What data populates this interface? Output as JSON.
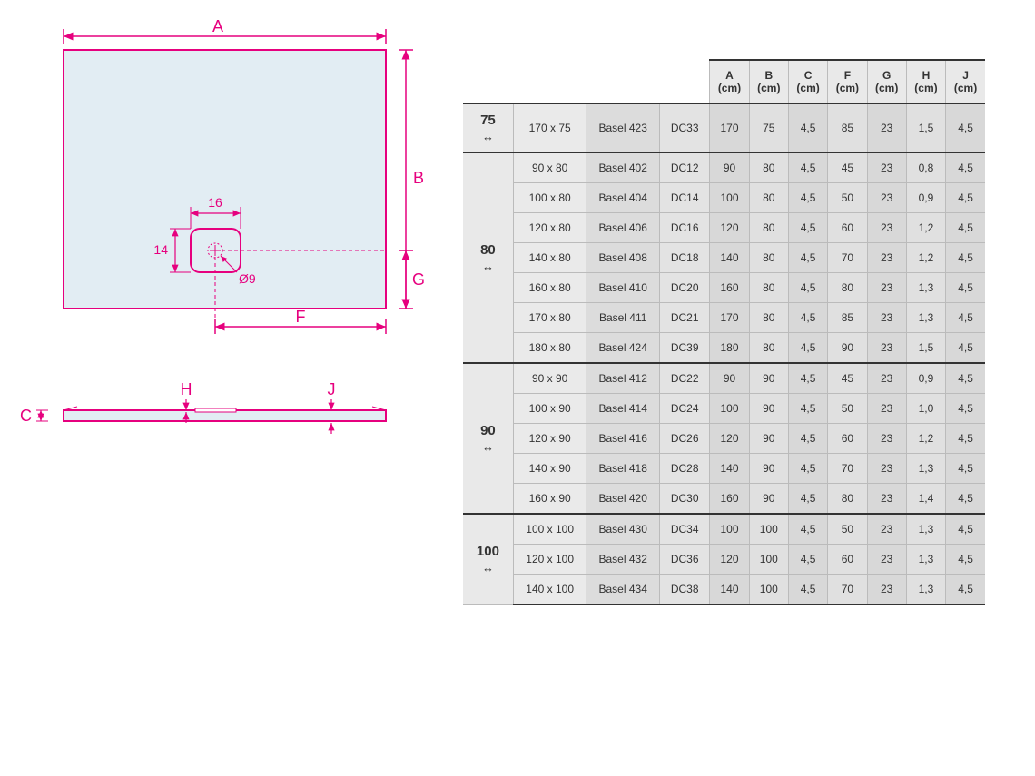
{
  "diagram": {
    "labels": {
      "A": "A",
      "B": "B",
      "C": "C",
      "F": "F",
      "G": "G",
      "H": "H",
      "J": "J",
      "drain_w": "16",
      "drain_h": "14",
      "drain_dia": "Ø9"
    },
    "colors": {
      "annotation": "#e6007e",
      "fill": "#e2edf3",
      "outline": "#e6007e"
    }
  },
  "table": {
    "columns": [
      "A (cm)",
      "B (cm)",
      "C (cm)",
      "F (cm)",
      "G (cm)",
      "H (cm)",
      "J (cm)"
    ],
    "groups": [
      {
        "width": "75",
        "rows": [
          {
            "size": "170 x 75",
            "model": "Basel 423",
            "code": "DC33",
            "A": "170",
            "B": "75",
            "C": "4,5",
            "F": "85",
            "G": "23",
            "H": "1,5",
            "J": "4,5"
          }
        ]
      },
      {
        "width": "80",
        "rows": [
          {
            "size": "90 x 80",
            "model": "Basel 402",
            "code": "DC12",
            "A": "90",
            "B": "80",
            "C": "4,5",
            "F": "45",
            "G": "23",
            "H": "0,8",
            "J": "4,5"
          },
          {
            "size": "100 x 80",
            "model": "Basel 404",
            "code": "DC14",
            "A": "100",
            "B": "80",
            "C": "4,5",
            "F": "50",
            "G": "23",
            "H": "0,9",
            "J": "4,5"
          },
          {
            "size": "120 x 80",
            "model": "Basel 406",
            "code": "DC16",
            "A": "120",
            "B": "80",
            "C": "4,5",
            "F": "60",
            "G": "23",
            "H": "1,2",
            "J": "4,5"
          },
          {
            "size": "140 x 80",
            "model": "Basel 408",
            "code": "DC18",
            "A": "140",
            "B": "80",
            "C": "4,5",
            "F": "70",
            "G": "23",
            "H": "1,2",
            "J": "4,5"
          },
          {
            "size": "160 x 80",
            "model": "Basel 410",
            "code": "DC20",
            "A": "160",
            "B": "80",
            "C": "4,5",
            "F": "80",
            "G": "23",
            "H": "1,3",
            "J": "4,5"
          },
          {
            "size": "170 x 80",
            "model": "Basel 411",
            "code": "DC21",
            "A": "170",
            "B": "80",
            "C": "4,5",
            "F": "85",
            "G": "23",
            "H": "1,3",
            "J": "4,5"
          },
          {
            "size": "180 x 80",
            "model": "Basel 424",
            "code": "DC39",
            "A": "180",
            "B": "80",
            "C": "4,5",
            "F": "90",
            "G": "23",
            "H": "1,5",
            "J": "4,5"
          }
        ]
      },
      {
        "width": "90",
        "rows": [
          {
            "size": "90 x 90",
            "model": "Basel 412",
            "code": "DC22",
            "A": "90",
            "B": "90",
            "C": "4,5",
            "F": "45",
            "G": "23",
            "H": "0,9",
            "J": "4,5"
          },
          {
            "size": "100 x 90",
            "model": "Basel 414",
            "code": "DC24",
            "A": "100",
            "B": "90",
            "C": "4,5",
            "F": "50",
            "G": "23",
            "H": "1,0",
            "J": "4,5"
          },
          {
            "size": "120 x 90",
            "model": "Basel 416",
            "code": "DC26",
            "A": "120",
            "B": "90",
            "C": "4,5",
            "F": "60",
            "G": "23",
            "H": "1,2",
            "J": "4,5"
          },
          {
            "size": "140 x 90",
            "model": "Basel 418",
            "code": "DC28",
            "A": "140",
            "B": "90",
            "C": "4,5",
            "F": "70",
            "G": "23",
            "H": "1,3",
            "J": "4,5"
          },
          {
            "size": "160 x 90",
            "model": "Basel 420",
            "code": "DC30",
            "A": "160",
            "B": "90",
            "C": "4,5",
            "F": "80",
            "G": "23",
            "H": "1,4",
            "J": "4,5"
          }
        ]
      },
      {
        "width": "100",
        "rows": [
          {
            "size": "100 x 100",
            "model": "Basel 430",
            "code": "DC34",
            "A": "100",
            "B": "100",
            "C": "4,5",
            "F": "50",
            "G": "23",
            "H": "1,3",
            "J": "4,5"
          },
          {
            "size": "120 x 100",
            "model": "Basel 432",
            "code": "DC36",
            "A": "120",
            "B": "100",
            "C": "4,5",
            "F": "60",
            "G": "23",
            "H": "1,3",
            "J": "4,5"
          },
          {
            "size": "140 x 100",
            "model": "Basel 434",
            "code": "DC38",
            "A": "140",
            "B": "100",
            "C": "4,5",
            "F": "70",
            "G": "23",
            "H": "1,3",
            "J": "4,5"
          }
        ]
      }
    ]
  }
}
